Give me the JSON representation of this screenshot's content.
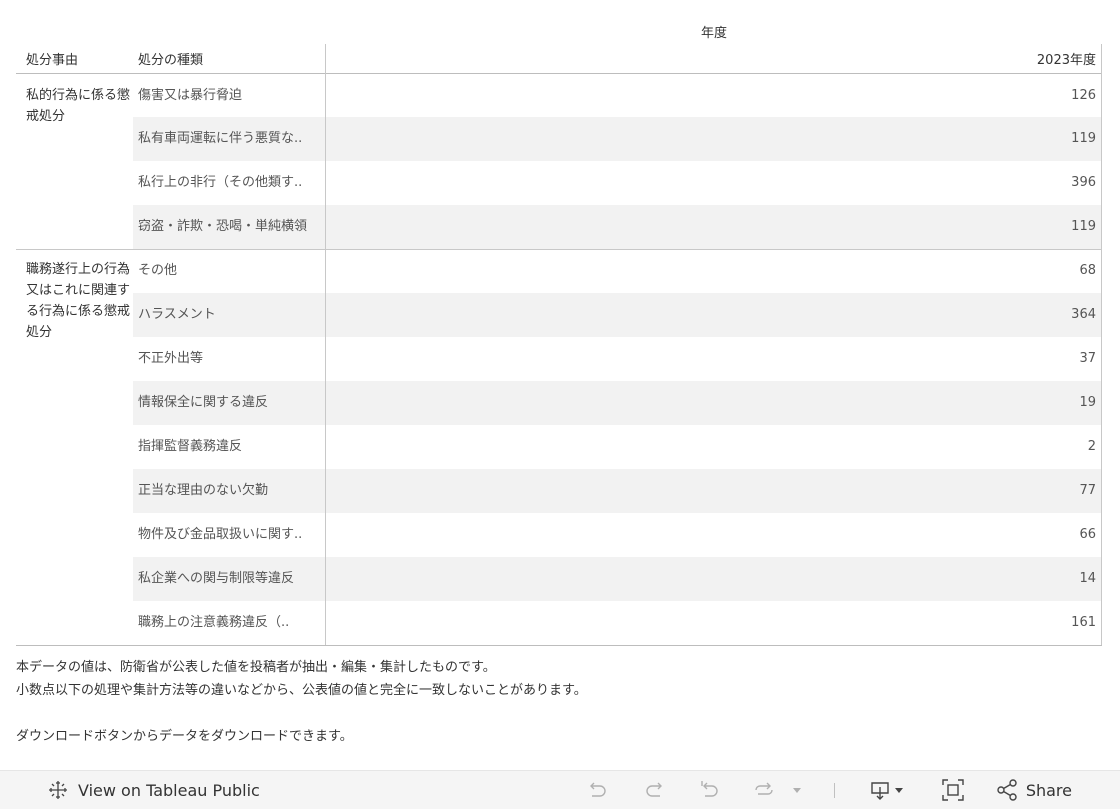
{
  "table": {
    "column_group_header": "年度",
    "header_reason": "処分事由",
    "header_type": "処分の種類",
    "header_year": "2023年度",
    "groups": [
      {
        "reason": "私的行為に係る懲戒処分",
        "rows": [
          {
            "type": "傷害又は暴行脅迫",
            "value": "126"
          },
          {
            "type": "私有車両運転に伴う悪質な..",
            "value": "119"
          },
          {
            "type": "私行上の非行（その他類す..",
            "value": "396"
          },
          {
            "type": "窃盗・詐欺・恐喝・単純横領",
            "value": "119"
          }
        ]
      },
      {
        "reason": "職務遂行上の行為又はこれに関連する行為に係る懲戒処分",
        "rows": [
          {
            "type": "その他",
            "value": "68"
          },
          {
            "type": "ハラスメント",
            "value": "364"
          },
          {
            "type": "不正外出等",
            "value": "37"
          },
          {
            "type": "情報保全に関する違反",
            "value": "19"
          },
          {
            "type": "指揮監督義務違反",
            "value": "2"
          },
          {
            "type": "正当な理由のない欠勤",
            "value": "77"
          },
          {
            "type": "物件及び金品取扱いに関す..",
            "value": "66"
          },
          {
            "type": "私企業への関与制限等違反",
            "value": "14"
          },
          {
            "type": "職務上の注意義務違反（..",
            "value": "161"
          }
        ]
      }
    ]
  },
  "notes": {
    "line1": "本データの値は、防衛省が公表した値を投稿者が抽出・編集・集計したものです。",
    "line2": "小数点以下の処理や集計方法等の違いなどから、公表値の値と完全に一致しないことがあります。",
    "line3": "",
    "line4": "ダウンロードボタンからデータをダウンロードできます。"
  },
  "toolbar": {
    "view_on_tableau": "View on Tableau Public",
    "share": "Share",
    "icons": [
      "tableau-logo-icon",
      "undo-icon",
      "redo-icon",
      "revert-icon",
      "refresh-icon",
      "pause-dropdown-icon",
      "download-icon",
      "fullscreen-icon",
      "share-icon"
    ]
  }
}
